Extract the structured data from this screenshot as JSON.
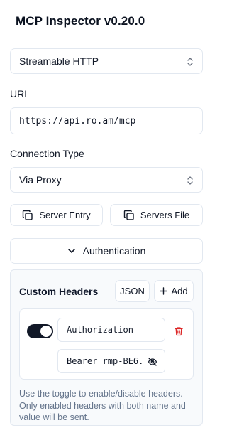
{
  "header": {
    "title": "MCP Inspector v0.20.0"
  },
  "transport": {
    "value": "Streamable HTTP"
  },
  "url": {
    "label": "URL",
    "value": "https://api.ro.am/mcp"
  },
  "connection": {
    "label": "Connection Type",
    "value": "Via Proxy"
  },
  "config_buttons": {
    "server_entry": "Server Entry",
    "servers_file": "Servers File"
  },
  "auth": {
    "label": "Authentication"
  },
  "custom_headers": {
    "title": "Custom Headers",
    "json_label": "JSON",
    "add_label": "Add",
    "rows": [
      {
        "enabled": true,
        "name": "Authorization",
        "value": "Bearer rmp-BE6."
      }
    ],
    "help": "Use the toggle to enable/disable headers. Only enabled headers with both name and value will be sent."
  }
}
